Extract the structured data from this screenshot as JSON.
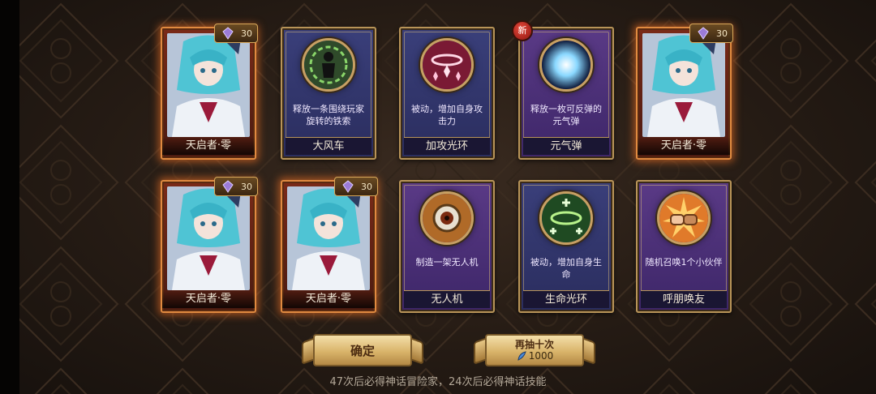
{
  "cards": [
    {
      "type": "hero",
      "name": "天启者·零",
      "cost": "30"
    },
    {
      "type": "skill",
      "name": "大风车",
      "desc": "释放一条围绕玩家旋转的铁索",
      "icon": "spinning-chain-icon"
    },
    {
      "type": "skill",
      "name": "加攻光环",
      "desc": "被动，增加自身攻击力",
      "icon": "attack-aura-icon"
    },
    {
      "type": "skill",
      "name": "元气弹",
      "desc": "释放一枚可反弹的元气弹",
      "icon": "energy-ball-icon",
      "badge": "新"
    },
    {
      "type": "hero",
      "name": "天启者·零",
      "cost": "30"
    },
    {
      "type": "hero",
      "name": "天启者·零",
      "cost": "30"
    },
    {
      "type": "hero",
      "name": "天启者·零",
      "cost": "30"
    },
    {
      "type": "skill",
      "name": "无人机",
      "desc": "制造一架无人机",
      "icon": "drone-icon"
    },
    {
      "type": "skill",
      "name": "生命光环",
      "desc": "被动，增加自身生命",
      "icon": "life-aura-icon"
    },
    {
      "type": "skill",
      "name": "呼朋唤友",
      "desc": "随机召唤1个小伙伴",
      "icon": "fist-bump-icon"
    }
  ],
  "buttons": {
    "confirm": "确定",
    "draw_ten": "再抽十次",
    "draw_ten_cost": "1000"
  },
  "footer": "47次后必得神话冒险家，24次后必得神话技能",
  "colors": {
    "background": "#251b14",
    "hero_glow": "#ff7828",
    "frame_gold": "#b89458",
    "skill_blue": "#2a2d5e",
    "skill_purple": "#3d2668"
  }
}
